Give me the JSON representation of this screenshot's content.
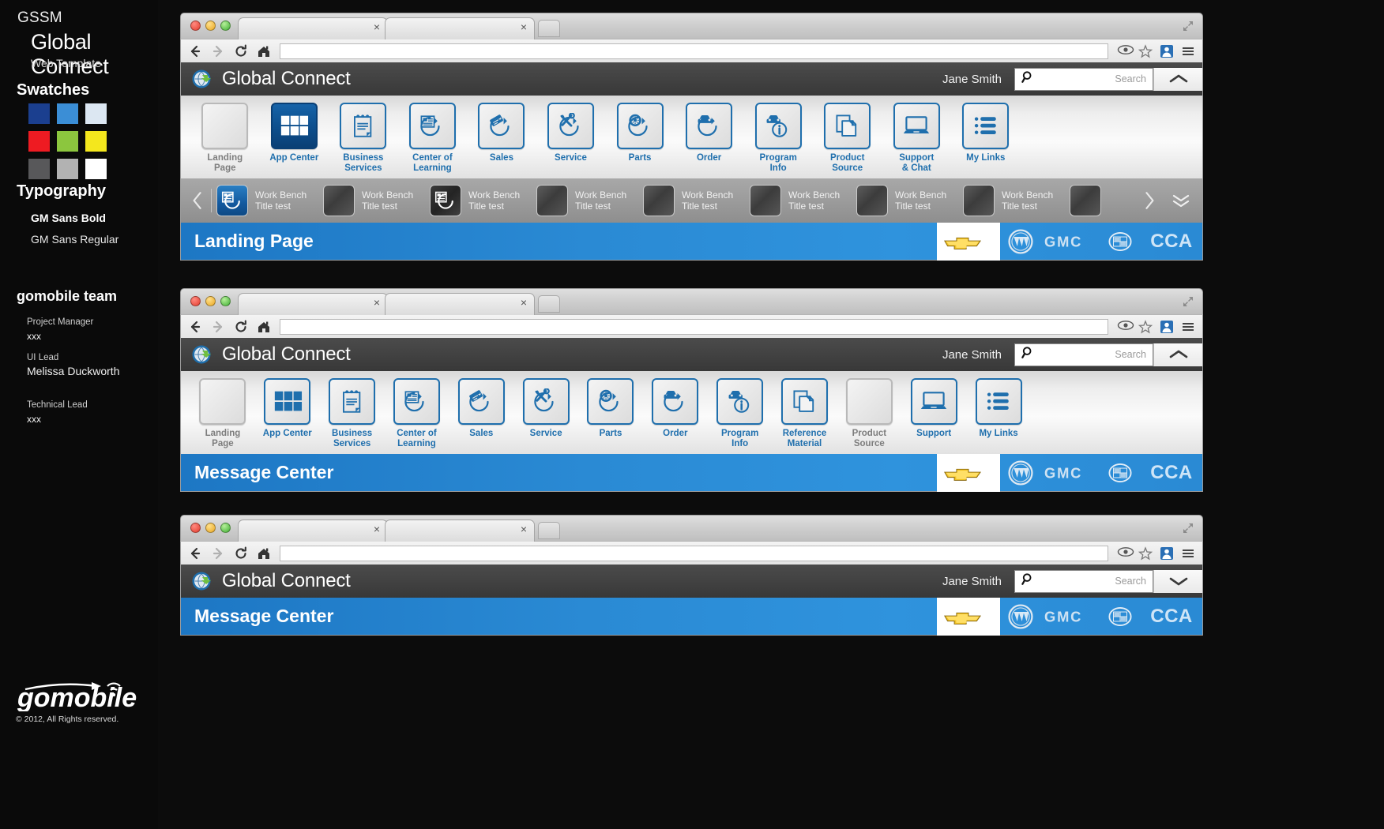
{
  "sidebar": {
    "brand_small": "GSSM",
    "brand_main": "Global Connect",
    "brand_sub": "Web Template",
    "swatches_title": "Swatches",
    "swatches": [
      [
        "#1b3f8f",
        "#3b8ed6",
        "#dce7f2"
      ],
      [
        "#ee1b22",
        "#8cc63e",
        "#f4e71d"
      ],
      [
        "#58585a",
        "#b2b2b2",
        "#ffffff"
      ]
    ],
    "typography_title": "Typography",
    "type_bold": "GM Sans Bold",
    "type_regular": "GM Sans Regular",
    "team_title": "gomobile team",
    "team": [
      {
        "role": "Project Manager",
        "name": "xxx"
      },
      {
        "role": "UI Lead",
        "name": "Melissa Duckworth"
      },
      {
        "role": "Technical Lead",
        "name": "xxx"
      }
    ],
    "logo_text": "gomobile",
    "copyright": "© 2012, All Rights reserved."
  },
  "browser": {
    "back_icon": "back-arrow-icon",
    "forward_icon": "forward-arrow-icon",
    "reload_icon": "reload-icon",
    "home_icon": "home-icon",
    "url_value": "",
    "url_placeholder": "",
    "tab_close_label": "×",
    "eye_icon": "eye-icon",
    "star_icon": "star-icon",
    "user_icon": "user-icon",
    "menu_icon": "hamburger-menu-icon"
  },
  "app": {
    "title": "Global Connect",
    "user": "Jane Smith",
    "search_placeholder": "Search",
    "search_value": "",
    "search_icon": "search-icon",
    "logo_icon": "globe-arrow-logo-icon",
    "collapse_icon": "chevron-up-icon",
    "expand_icon": "chevron-down-icon"
  },
  "colors": {
    "accent_blue": "#1f6fad",
    "bar_blue": "#2a8ad4",
    "active_tile": "#0d4e8c",
    "header_grey": "#414141",
    "workbench_grey": "#9d9d9d"
  },
  "window1": {
    "nav": [
      {
        "label": "Landing\nPage",
        "label_l1": "Landing",
        "label_l2": "Page",
        "icon": "landing-page-icon",
        "state": "empty"
      },
      {
        "label": "App Center",
        "label_l1": "App Center",
        "label_l2": "",
        "icon": "grid-icon",
        "state": "active"
      },
      {
        "label": "Business\nServices",
        "label_l1": "Business",
        "label_l2": "Services",
        "icon": "notepad-icon",
        "state": "normal"
      },
      {
        "label": "Center of\nLearning",
        "label_l1": "Center of",
        "label_l2": "Learning",
        "icon": "article-refresh-icon",
        "state": "normal"
      },
      {
        "label": "Sales",
        "label_l1": "Sales",
        "label_l2": "",
        "icon": "tag-refresh-icon",
        "state": "normal"
      },
      {
        "label": "Service",
        "label_l1": "Service",
        "label_l2": "",
        "icon": "tools-refresh-icon",
        "state": "normal"
      },
      {
        "label": "Parts",
        "label_l1": "Parts",
        "label_l2": "",
        "icon": "wheel-refresh-icon",
        "state": "normal"
      },
      {
        "label": "Order",
        "label_l1": "Order",
        "label_l2": "",
        "icon": "car-refresh-icon",
        "state": "normal"
      },
      {
        "label": "Program\nInfo",
        "label_l1": "Program",
        "label_l2": "Info",
        "icon": "car-info-icon",
        "state": "normal"
      },
      {
        "label": "Product\nSource",
        "label_l1": "Product",
        "label_l2": "Source",
        "icon": "copy-docs-icon",
        "state": "normal"
      },
      {
        "label": "Support\n& Chat",
        "label_l1": "Support",
        "label_l2": "& Chat",
        "icon": "laptop-icon",
        "state": "normal"
      },
      {
        "label": "My Links",
        "label_l1": "My Links",
        "label_l2": "",
        "icon": "list-icon",
        "state": "normal"
      }
    ],
    "workbench": {
      "prev_icon": "chevron-left-icon",
      "next_icon": "chevron-right-icon",
      "more_icon": "double-chevron-down-icon",
      "items": [
        {
          "title_l1": "Work Bench",
          "title_l2": "Title test",
          "icon": "workbench-doc-icon",
          "state": "active"
        },
        {
          "title_l1": "Work Bench",
          "title_l2": "Title test",
          "icon": "workbench-blank-icon",
          "state": "blank"
        },
        {
          "title_l1": "Work Bench",
          "title_l2": "Title test",
          "icon": "workbench-doc-icon",
          "state": "dark"
        },
        {
          "title_l1": "Work Bench",
          "title_l2": "Title test",
          "icon": "workbench-blank-icon",
          "state": "blank"
        },
        {
          "title_l1": "Work Bench",
          "title_l2": "Title test",
          "icon": "workbench-blank-icon",
          "state": "blank"
        },
        {
          "title_l1": "Work Bench",
          "title_l2": "Title test",
          "icon": "workbench-blank-icon",
          "state": "blank"
        },
        {
          "title_l1": "Work Bench",
          "title_l2": "Title test",
          "icon": "workbench-blank-icon",
          "state": "blank"
        },
        {
          "title_l1": "Work Bench",
          "title_l2": "Title test",
          "icon": "workbench-blank-icon",
          "state": "blank"
        },
        {
          "title_l1": "",
          "title_l2": "",
          "icon": "workbench-blank-icon",
          "state": "blank"
        }
      ]
    },
    "page_title": "Landing Page"
  },
  "window2": {
    "nav": [
      {
        "label_l1": "Landing",
        "label_l2": "Page",
        "icon": "landing-page-icon",
        "state": "empty"
      },
      {
        "label_l1": "App Center",
        "label_l2": "",
        "icon": "grid-icon",
        "state": "normal"
      },
      {
        "label_l1": "Business",
        "label_l2": "Services",
        "icon": "notepad-icon",
        "state": "normal"
      },
      {
        "label_l1": "Center of",
        "label_l2": "Learning",
        "icon": "article-refresh-icon",
        "state": "normal"
      },
      {
        "label_l1": "Sales",
        "label_l2": "",
        "icon": "tag-refresh-icon",
        "state": "normal"
      },
      {
        "label_l1": "Service",
        "label_l2": "",
        "icon": "tools-refresh-icon",
        "state": "normal"
      },
      {
        "label_l1": "Parts",
        "label_l2": "",
        "icon": "wheel-refresh-icon",
        "state": "normal"
      },
      {
        "label_l1": "Order",
        "label_l2": "",
        "icon": "car-refresh-icon",
        "state": "normal"
      },
      {
        "label_l1": "Program",
        "label_l2": "Info",
        "icon": "car-info-icon",
        "state": "normal"
      },
      {
        "label_l1": "Reference",
        "label_l2": "Material",
        "icon": "copy-docs-icon",
        "state": "normal"
      },
      {
        "label_l1": "Product",
        "label_l2": "Source",
        "icon": "blank-icon",
        "state": "empty"
      },
      {
        "label_l1": "Support",
        "label_l2": "",
        "icon": "laptop-icon",
        "state": "normal"
      },
      {
        "label_l1": "My Links",
        "label_l2": "",
        "icon": "list-icon",
        "state": "normal"
      }
    ],
    "page_title": "Message Center"
  },
  "window3": {
    "page_title": "Message Center"
  },
  "brands": [
    {
      "name": "chevrolet",
      "label": ""
    },
    {
      "name": "buick",
      "label": ""
    },
    {
      "name": "gmc",
      "label": "GMC"
    },
    {
      "name": "cadillac",
      "label": ""
    },
    {
      "name": "cca",
      "label": "CCA"
    }
  ]
}
